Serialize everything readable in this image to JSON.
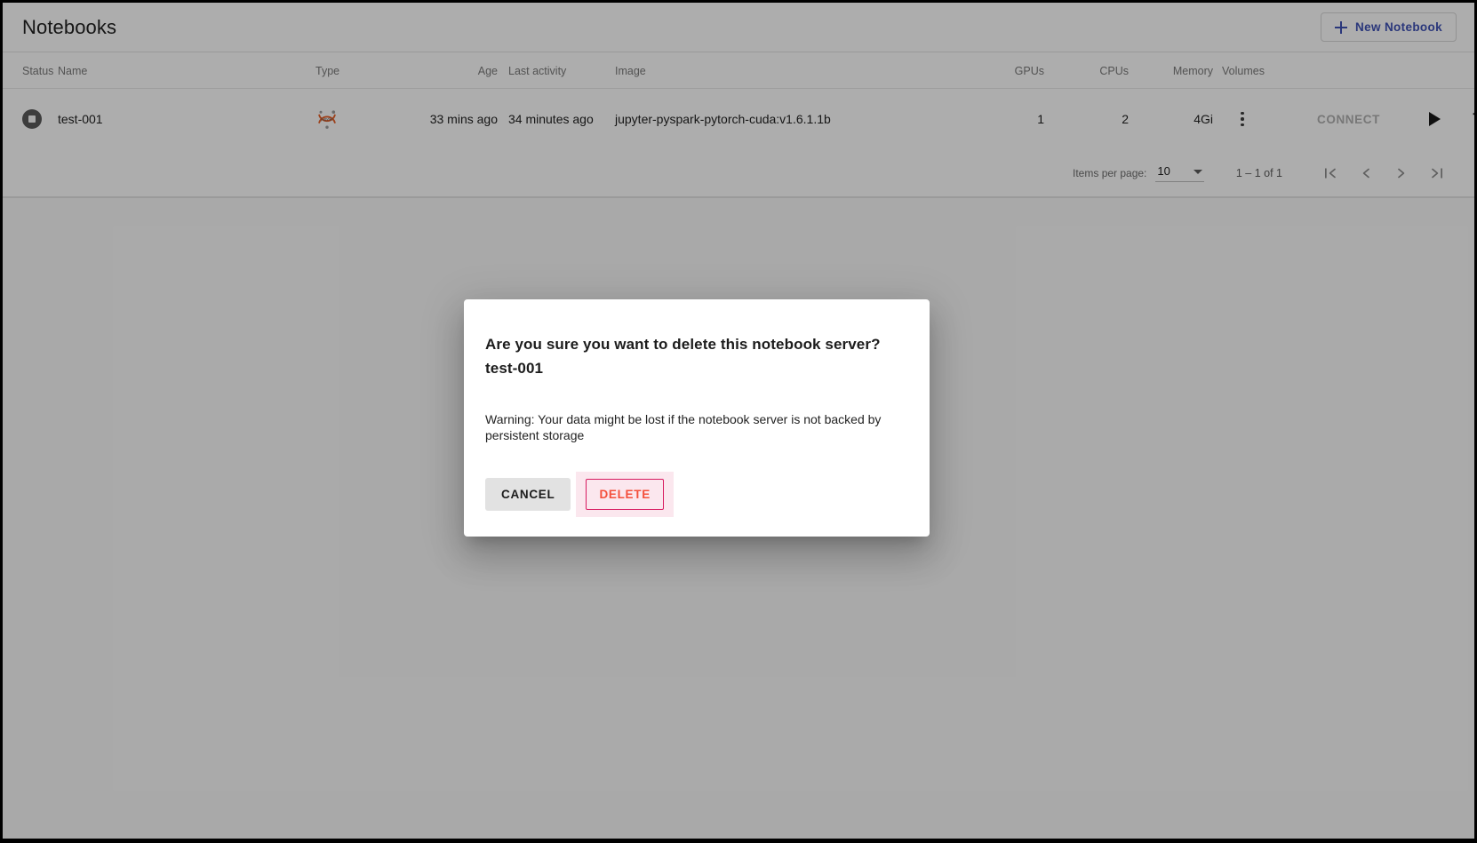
{
  "header": {
    "title": "Notebooks",
    "new_notebook_label": "New Notebook",
    "plus_icon": "plus-icon"
  },
  "colors": {
    "accent": "#3f51b5",
    "delete_text": "#f4503c",
    "delete_border": "#d81b60",
    "delete_focus_bg": "#fbe7ee",
    "cancel_bg": "#e2e2e2",
    "status_icon": "#5a5a5a",
    "scrim": "rgba(0,0,0,0.32)"
  },
  "table": {
    "columns": [
      "Status",
      "Name",
      "Type",
      "Age",
      "Last activity",
      "Image",
      "GPUs",
      "CPUs",
      "Memory",
      "Volumes",
      ""
    ],
    "rows": [
      {
        "status_icon": "stop-circle-icon",
        "name": "test-001",
        "type_icon": "jupyter-logo-icon",
        "age": "33 mins ago",
        "last_activity": "34 minutes ago",
        "image": "jupyter-pyspark-pytorch-cuda:v1.6.1.1b",
        "gpus": "1",
        "cpus": "2",
        "memory": "4Gi",
        "volumes_icon": "kebab-menu-icon",
        "connect_label": "CONNECT",
        "start_icon": "play-icon",
        "delete_icon": "trash-icon"
      }
    ]
  },
  "paginator": {
    "items_per_page_label": "Items per page:",
    "items_per_page_value": "10",
    "range_label": "1 – 1 of 1",
    "first_page_icon": "first-page-icon",
    "prev_page_icon": "previous-page-icon",
    "next_page_icon": "next-page-icon",
    "last_page_icon": "last-page-icon"
  },
  "dialog": {
    "title": "Are you sure you want to delete this notebook server? test-001",
    "body": "Warning: Your data might be lost if the notebook server is not backed by persistent storage",
    "cancel_label": "CANCEL",
    "delete_label": "DELETE"
  }
}
